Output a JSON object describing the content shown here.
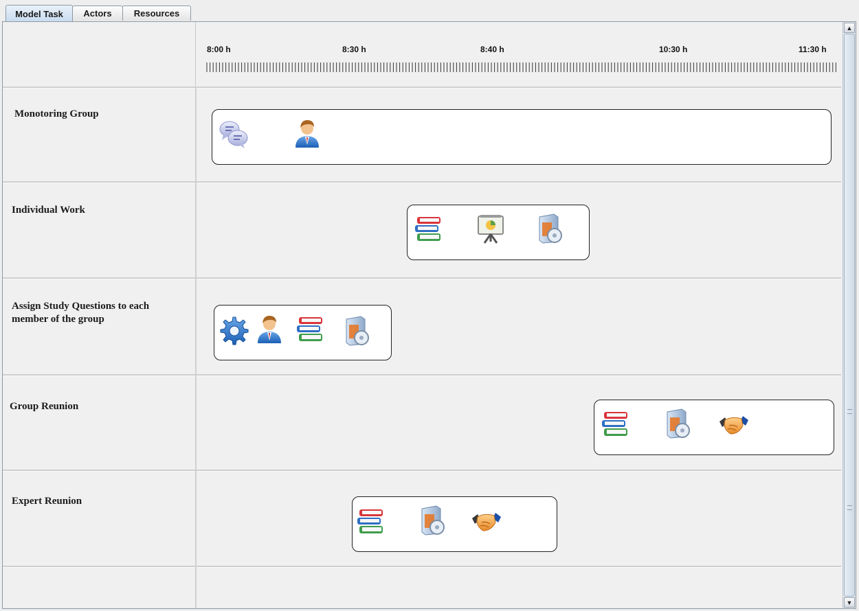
{
  "tabs": [
    {
      "label": "Model Task",
      "active": true
    },
    {
      "label": "Actors",
      "active": false
    },
    {
      "label": "Resources",
      "active": false
    }
  ],
  "timeline": {
    "time_labels": [
      "8:00 h",
      "8:30 h",
      "8:40 h",
      "10:30 h",
      "11:30 h"
    ]
  },
  "rows": [
    {
      "label": "Monotoring Group",
      "icons": [
        "chat-bubbles-icon",
        "person-icon"
      ]
    },
    {
      "label": "Individual Work",
      "icons": [
        "books-icon",
        "presentation-board-icon",
        "software-box-icon"
      ]
    },
    {
      "label": "Assign Study Questions to each member of the group",
      "icons": [
        "gear-icon",
        "person-icon",
        "books-icon",
        "software-box-icon"
      ]
    },
    {
      "label": "Group Reunion",
      "icons": [
        "books-icon",
        "software-box-icon",
        "handshake-icon"
      ]
    },
    {
      "label": "Expert Reunion",
      "icons": [
        "books-icon",
        "software-box-icon",
        "handshake-icon"
      ]
    },
    {
      "label": "",
      "icons": []
    }
  ],
  "colors": {
    "tab_active": "#c7dbef",
    "task_box_fill": "#ffffff",
    "task_box_border": "#222222",
    "background": "#f0f0f0"
  }
}
